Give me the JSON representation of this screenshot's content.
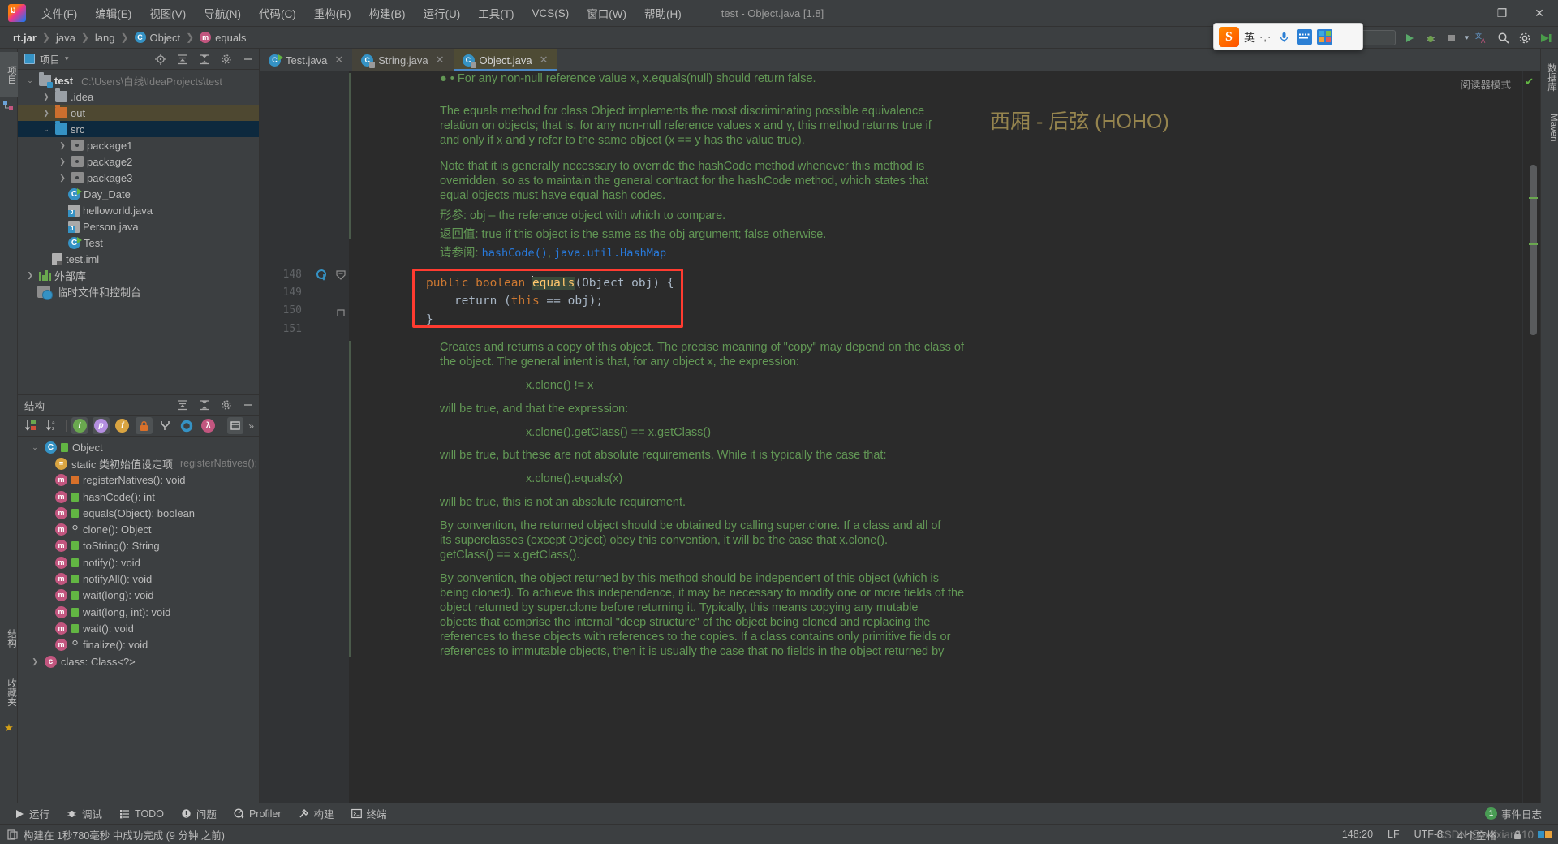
{
  "titlebar": {
    "menu": [
      "文件(F)",
      "编辑(E)",
      "视图(V)",
      "导航(N)",
      "代码(C)",
      "重构(R)",
      "构建(B)",
      "运行(U)",
      "工具(T)",
      "VCS(S)",
      "窗口(W)",
      "帮助(H)"
    ],
    "window_title": "test - Object.java [1.8]",
    "minimize": "—",
    "maximize": "❐",
    "close": "✕"
  },
  "navbar": {
    "crumbs": [
      {
        "label": "rt.jar",
        "icon": ""
      },
      {
        "label": "java",
        "icon": ""
      },
      {
        "label": "lang",
        "icon": ""
      },
      {
        "label": "Object",
        "icon": "class-icon"
      },
      {
        "label": "equals",
        "icon": "method-icon"
      }
    ],
    "separator": "❯"
  },
  "ime": {
    "app": "搜狗输入法",
    "mode": "英",
    "dots": "·,·",
    "mic": "mic-icon",
    "keyboard": "keyboard-icon",
    "apps": "apps-icon"
  },
  "left_rail": {
    "tabs": [
      "项目",
      "结构",
      "收藏夹"
    ]
  },
  "project_panel": {
    "title": "项目",
    "dropdown": "▾",
    "actions": [
      "locate-icon",
      "expand-all-icon",
      "collapse-all-icon",
      "settings-icon",
      "hide-icon"
    ],
    "tree": [
      {
        "label": "test",
        "path": "C:\\Users\\白线\\IdeaProjects\\test",
        "arrow": "⌄",
        "indent": 0,
        "icon": "module-folder",
        "bold": true,
        "state": "normal"
      },
      {
        "label": ".idea",
        "path": "",
        "arrow": "❯",
        "indent": 1,
        "icon": "folder-gray",
        "bold": false,
        "state": "normal"
      },
      {
        "label": "out",
        "path": "",
        "arrow": "❯",
        "indent": 1,
        "icon": "folder-orange",
        "bold": false,
        "state": "highlight"
      },
      {
        "label": "src",
        "path": "",
        "arrow": "⌄",
        "indent": 1,
        "icon": "folder-blue",
        "bold": false,
        "state": "selected"
      },
      {
        "label": "package1",
        "path": "",
        "arrow": "❯",
        "indent": 2,
        "icon": "package-folder",
        "bold": false,
        "state": "normal"
      },
      {
        "label": "package2",
        "path": "",
        "arrow": "❯",
        "indent": 2,
        "icon": "package-folder",
        "bold": false,
        "state": "normal"
      },
      {
        "label": "package3",
        "path": "",
        "arrow": "❯",
        "indent": 2,
        "icon": "package-folder",
        "bold": false,
        "state": "normal"
      },
      {
        "label": "Day_Date",
        "path": "",
        "arrow": "",
        "indent": 2,
        "icon": "class-runnable",
        "bold": false,
        "state": "normal"
      },
      {
        "label": "helloworld.java",
        "path": "",
        "arrow": "",
        "indent": 2,
        "icon": "java-file",
        "bold": false,
        "state": "normal"
      },
      {
        "label": "Person.java",
        "path": "",
        "arrow": "",
        "indent": 2,
        "icon": "java-file",
        "bold": false,
        "state": "normal"
      },
      {
        "label": "Test",
        "path": "",
        "arrow": "",
        "indent": 2,
        "icon": "class-runnable",
        "bold": false,
        "state": "normal"
      },
      {
        "label": "test.iml",
        "path": "",
        "arrow": "",
        "indent": 1,
        "icon": "iml-file",
        "bold": false,
        "state": "normal"
      },
      {
        "label": "外部库",
        "path": "",
        "arrow": "❯",
        "indent": 0,
        "icon": "library-icon",
        "bold": false,
        "state": "normal"
      },
      {
        "label": "临时文件和控制台",
        "path": "",
        "arrow": "",
        "indent": 0,
        "icon": "scratch-icon",
        "bold": false,
        "state": "normal"
      }
    ]
  },
  "structure_panel": {
    "title": "结构",
    "actions": [
      "expand-all-icon",
      "collapse-all-icon",
      "settings-icon",
      "hide-icon"
    ],
    "toolbar": [
      {
        "name": "sort-by-visibility-icon",
        "glyph": "↓",
        "on": false
      },
      {
        "name": "sort-alphabetically-icon",
        "glyph": "↓",
        "on": false
      },
      {
        "name": "show-inherited-icon",
        "glyph": "I",
        "on": true
      },
      {
        "name": "show-properties-icon",
        "glyph": "p",
        "on": true
      },
      {
        "name": "show-fields-icon",
        "glyph": "f",
        "on": false
      },
      {
        "name": "show-non-public-icon",
        "glyph": "🔒",
        "on": true
      },
      {
        "name": "show-anonymous-icon",
        "glyph": "Y",
        "on": false
      },
      {
        "name": "show-interfaces-icon",
        "glyph": "O",
        "on": false
      },
      {
        "name": "show-lambdas-icon",
        "glyph": "λ",
        "on": false
      },
      {
        "name": "group-icon",
        "glyph": "▣",
        "on": true
      },
      {
        "name": "more-icon",
        "glyph": "»",
        "on": false
      }
    ],
    "tree": [
      {
        "label": "Object",
        "extra": "",
        "arrow": "⌄",
        "indent": 0,
        "icon": "class-icon",
        "vis": "protected"
      },
      {
        "label": "static 类初始值设定项",
        "extra": "registerNatives();",
        "arrow": "",
        "indent": 1,
        "icon": "static-init-icon",
        "vis": "none"
      },
      {
        "label": "registerNatives(): void",
        "extra": "",
        "arrow": "",
        "indent": 1,
        "icon": "method-icon",
        "vis": "private"
      },
      {
        "label": "hashCode(): int",
        "extra": "",
        "arrow": "",
        "indent": 1,
        "icon": "method-icon",
        "vis": "public"
      },
      {
        "label": "equals(Object): boolean",
        "extra": "",
        "arrow": "",
        "indent": 1,
        "icon": "method-icon",
        "vis": "public"
      },
      {
        "label": "clone(): Object",
        "extra": "",
        "arrow": "",
        "indent": 1,
        "icon": "method-icon",
        "vis": "protected"
      },
      {
        "label": "toString(): String",
        "extra": "",
        "arrow": "",
        "indent": 1,
        "icon": "method-icon",
        "vis": "public"
      },
      {
        "label": "notify(): void",
        "extra": "",
        "arrow": "",
        "indent": 1,
        "icon": "method-icon",
        "vis": "public"
      },
      {
        "label": "notifyAll(): void",
        "extra": "",
        "arrow": "",
        "indent": 1,
        "icon": "method-icon",
        "vis": "public"
      },
      {
        "label": "wait(long): void",
        "extra": "",
        "arrow": "",
        "indent": 1,
        "icon": "method-icon",
        "vis": "public"
      },
      {
        "label": "wait(long, int): void",
        "extra": "",
        "arrow": "",
        "indent": 1,
        "icon": "method-icon",
        "vis": "public"
      },
      {
        "label": "wait(): void",
        "extra": "",
        "arrow": "",
        "indent": 1,
        "icon": "method-icon",
        "vis": "public"
      },
      {
        "label": "finalize(): void",
        "extra": "",
        "arrow": "",
        "indent": 1,
        "icon": "method-icon",
        "vis": "protected"
      },
      {
        "label": "class: Class<?>",
        "extra": "",
        "arrow": "❯",
        "indent": 0,
        "icon": "class-icon",
        "vis": "none"
      }
    ]
  },
  "editor": {
    "tabs": [
      {
        "label": "Test.java",
        "icon": "class-runnable",
        "active": false,
        "close": "✕"
      },
      {
        "label": "String.java",
        "icon": "class-readonly",
        "active": false,
        "close": "✕"
      },
      {
        "label": "Object.java",
        "icon": "class-readonly",
        "active": true,
        "close": "✕"
      }
    ],
    "reader_mode": "阅读器模式",
    "line_numbers": [
      "148",
      "149",
      "150",
      "151"
    ],
    "javadoc_top": [
      {
        "text": "• For any non-null reference value x, x.equals(null) should return false.",
        "kind": "bullet"
      },
      {
        "text": "The equals method for class Object implements the most discriminating possible equivalence",
        "kind": "p"
      },
      {
        "text": "relation on objects; that is, for any non-null reference values x and y, this method returns true if",
        "kind": "p"
      },
      {
        "text": "and only if x and y refer to the same object (x == y has the value true).",
        "kind": "p"
      },
      {
        "text": "Note that it is generally necessary to override the hashCode method whenever this method is",
        "kind": "p"
      },
      {
        "text": "overridden, so as to maintain the general contract for the hashCode method, which states that",
        "kind": "p"
      },
      {
        "text": "equal objects must have equal hash codes.",
        "kind": "p"
      },
      {
        "text": "形参:    obj – the reference object with which to compare.",
        "kind": "tag"
      },
      {
        "text": "返回值: true if this object is the same as the obj argument; false otherwise.",
        "kind": "tag"
      },
      {
        "text": "请参阅: hashCode(), java.util.HashMap",
        "kind": "link"
      }
    ],
    "code": [
      "public boolean equals(Object obj) {",
      "    return (this == obj);",
      "}"
    ],
    "javadoc_bottom": [
      "Creates and returns a copy of this object. The precise meaning of \"copy\" may depend on the class of",
      "the object. The general intent is that, for any object x, the expression:",
      "x.clone() != x",
      "will be true, and that the expression:",
      "x.clone().getClass() == x.getClass()",
      "will be true, but these are not absolute requirements. While it is typically the case that:",
      "x.clone().equals(x)",
      "will be true, this is not an absolute requirement.",
      "By convention, the returned object should be obtained by calling super.clone. If a class and all of",
      "its superclasses (except Object) obey this convention, it will be the case that x.clone().",
      "getClass() == x.getClass().",
      "By convention, the object returned by this method should be independent of this object (which is",
      "being cloned). To achieve this independence, it may be necessary to modify one or more fields of the",
      "object returned by super.clone before returning it. Typically, this means copying any mutable",
      "objects that comprise the internal \"deep structure\" of the object being cloned and replacing the",
      "references to these objects with references to the copies. If a class contains only primitive fields or",
      "references to immutable objects, then it is usually the case that no fields in the object returned by"
    ],
    "watermark": "西厢 - 后弦 (HOHO)"
  },
  "right_rail": {
    "tabs": [
      "数据库",
      "Maven"
    ]
  },
  "bottom": {
    "buttons": [
      {
        "label": "运行",
        "icon": "run-icon"
      },
      {
        "label": "调试",
        "icon": "debug-icon"
      },
      {
        "label": "TODO",
        "icon": "todo-icon"
      },
      {
        "label": "问题",
        "icon": "problems-icon"
      },
      {
        "label": "Profiler",
        "icon": "profiler-icon"
      },
      {
        "label": "构建",
        "icon": "build-icon"
      },
      {
        "label": "终端",
        "icon": "terminal-icon"
      }
    ],
    "event_log": {
      "count": "1",
      "label": "事件日志"
    }
  },
  "statusbar": {
    "message": "构建在 1秒780毫秒 中成功完成 (9 分钟 之前)",
    "caret": "148:20",
    "line_sep": "LF",
    "encoding": "UTF-8",
    "indent": "4 个空格",
    "watermark": "CSDN @baixian110"
  }
}
